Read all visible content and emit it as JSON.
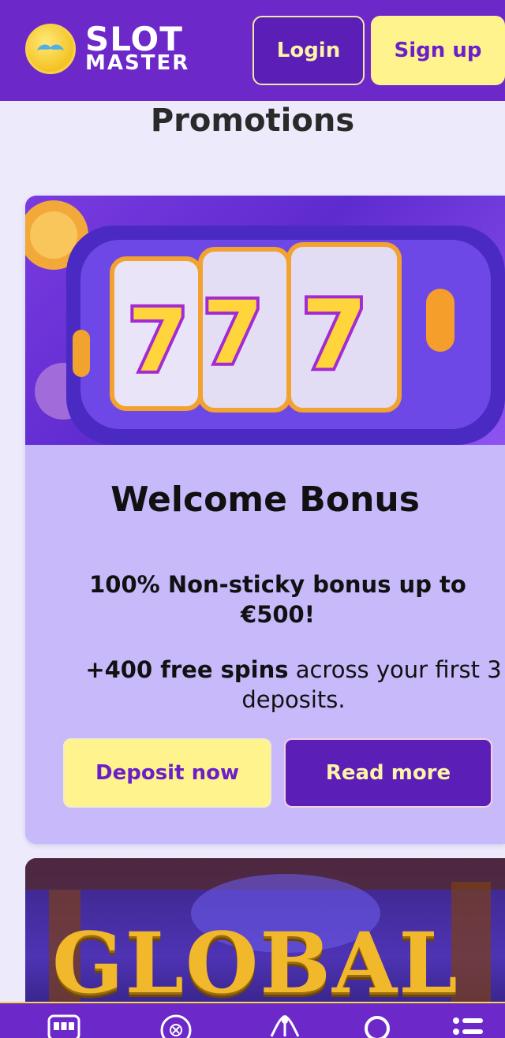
{
  "header": {
    "logo_line1": "SLOT",
    "logo_line2": "MASTER",
    "login_label": "Login",
    "signup_label": "Sign up"
  },
  "page_title": "Promotions",
  "promotions": [
    {
      "title": "Welcome Bonus",
      "bonus_text": "100% Non-sticky bonus up to €500!",
      "spins_bold": "+400 free spins",
      "spins_rest": " across your first 3 deposits.",
      "deposit_label": "Deposit now",
      "read_more_label": "Read more",
      "image_caption": "777"
    },
    {
      "image_caption": "GLOBAL"
    }
  ],
  "bottom_nav": {
    "items": [
      "slots-icon",
      "roulette-icon",
      "live-casino-icon",
      "search-icon",
      "menu-icon"
    ]
  },
  "colors": {
    "brand_purple": "#6D28C9",
    "accent_yellow": "#FFF38E",
    "card_lavender": "#C7B9FA",
    "page_bg": "#ECEAFB"
  }
}
